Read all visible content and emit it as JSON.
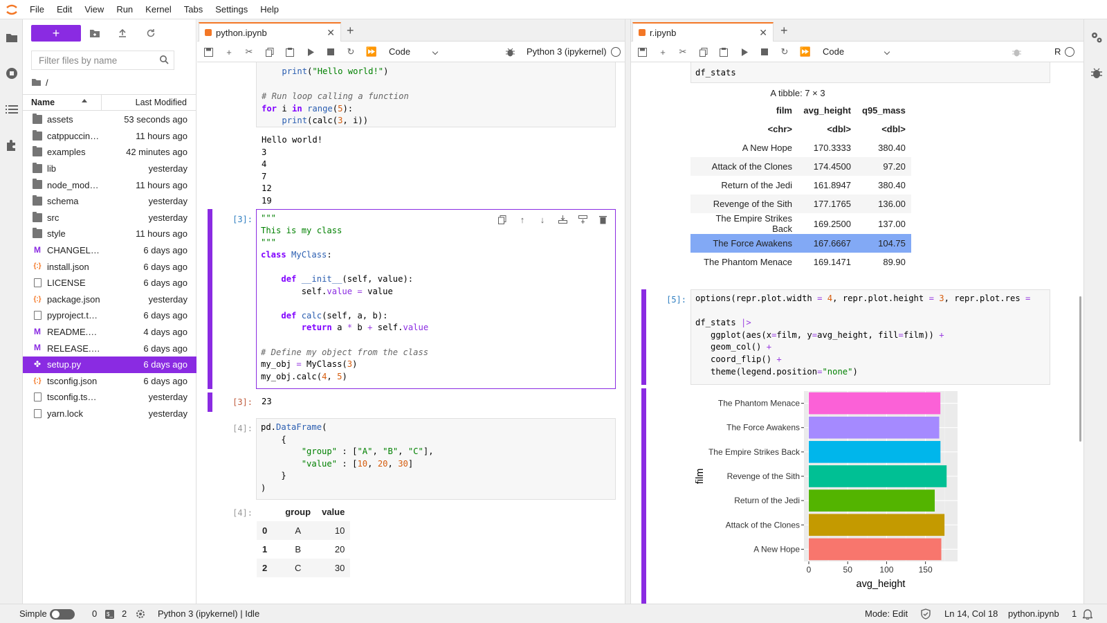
{
  "menubar": {
    "items": [
      "File",
      "Edit",
      "View",
      "Run",
      "Kernel",
      "Tabs",
      "Settings",
      "Help"
    ]
  },
  "filebrowser": {
    "filter_placeholder": "Filter files by name",
    "breadcrumb": "/",
    "col_name": "Name",
    "col_modified": "Last Modified",
    "files": [
      {
        "name": "assets",
        "type": "folder",
        "modified": "53 seconds ago"
      },
      {
        "name": "catppuccin…",
        "type": "folder",
        "modified": "11 hours ago"
      },
      {
        "name": "examples",
        "type": "folder",
        "modified": "42 minutes ago"
      },
      {
        "name": "lib",
        "type": "folder",
        "modified": "yesterday"
      },
      {
        "name": "node_mod…",
        "type": "folder",
        "modified": "11 hours ago"
      },
      {
        "name": "schema",
        "type": "folder",
        "modified": "yesterday"
      },
      {
        "name": "src",
        "type": "folder",
        "modified": "yesterday"
      },
      {
        "name": "style",
        "type": "folder",
        "modified": "11 hours ago"
      },
      {
        "name": "CHANGEL…",
        "type": "markdown",
        "modified": "6 days ago"
      },
      {
        "name": "install.json",
        "type": "json",
        "modified": "6 days ago"
      },
      {
        "name": "LICENSE",
        "type": "file",
        "modified": "6 days ago"
      },
      {
        "name": "package.json",
        "type": "json",
        "modified": "yesterday"
      },
      {
        "name": "pyproject.t…",
        "type": "file",
        "modified": "6 days ago"
      },
      {
        "name": "README.…",
        "type": "markdown",
        "modified": "4 days ago"
      },
      {
        "name": "RELEASE.…",
        "type": "markdown",
        "modified": "6 days ago"
      },
      {
        "name": "setup.py",
        "type": "python",
        "modified": "6 days ago",
        "selected": true
      },
      {
        "name": "tsconfig.json",
        "type": "json",
        "modified": "6 days ago"
      },
      {
        "name": "tsconfig.ts…",
        "type": "file",
        "modified": "yesterday"
      },
      {
        "name": "yarn.lock",
        "type": "file",
        "modified": "yesterday"
      }
    ]
  },
  "python_nb": {
    "tab_label": "python.ipynb",
    "cell_type": "Code",
    "kernel": "Python 3 (ipykernel)",
    "cell1_code": "    print(\"Hello world!\")",
    "cell1_comment": "# Run loop calling a function",
    "cell1_output": "Hello world!\n3\n4\n7\n12\n19",
    "cell3_prompt": "[3]:",
    "cell3_out": "23",
    "cell4_prompt": "[4]:",
    "df": {
      "columns": [
        "",
        "group",
        "value"
      ],
      "rows": [
        [
          "0",
          "A",
          "10"
        ],
        [
          "1",
          "B",
          "20"
        ],
        [
          "2",
          "C",
          "30"
        ]
      ]
    }
  },
  "r_nb": {
    "tab_label": "r.ipynb",
    "cell_type": "Code",
    "kernel": "R",
    "prev_code": "df_stats",
    "tibble_caption": "A tibble: 7 × 3",
    "tibble_columns": [
      "film",
      "avg_height",
      "q95_mass"
    ],
    "tibble_types": [
      "<chr>",
      "<dbl>",
      "<dbl>"
    ],
    "tibble_rows": [
      [
        "A New Hope",
        "170.3333",
        "380.40"
      ],
      [
        "Attack of the Clones",
        "174.4500",
        "97.20"
      ],
      [
        "Return of the Jedi",
        "161.8947",
        "380.40"
      ],
      [
        "Revenge of the Sith",
        "177.1765",
        "136.00"
      ],
      [
        "The Empire Strikes Back",
        "169.2500",
        "137.00"
      ],
      [
        "The Force Awakens",
        "167.6667",
        "104.75"
      ],
      [
        "The Phantom Menace",
        "169.1471",
        "89.90"
      ]
    ],
    "cell5_prompt": "[5]:"
  },
  "chart_data": {
    "type": "bar",
    "orientation": "horizontal",
    "categories": [
      "A New Hope",
      "Attack of the Clones",
      "Return of the Jedi",
      "Revenge of the Sith",
      "The Empire Strikes Back",
      "The Force Awakens",
      "The Phantom Menace"
    ],
    "values": [
      170.3333,
      174.45,
      161.8947,
      177.1765,
      169.25,
      167.6667,
      169.1471
    ],
    "colors": [
      "#F8766D",
      "#C49A00",
      "#53B400",
      "#00C094",
      "#00B6EB",
      "#A58AFF",
      "#FB61D7"
    ],
    "xlabel": "avg_height",
    "ylabel": "film",
    "xticks": [
      0,
      50,
      100,
      150
    ],
    "xlim": [
      0,
      185
    ],
    "grid": true,
    "legend": "none"
  },
  "statusbar": {
    "mode_label": "Simple",
    "terminals": "0",
    "kernels": "2",
    "kernel_status": "Python 3 (ipykernel) | Idle",
    "mode": "Mode: Edit",
    "cursor": "Ln 14, Col 18",
    "file": "python.ipynb",
    "notifications": "1"
  }
}
